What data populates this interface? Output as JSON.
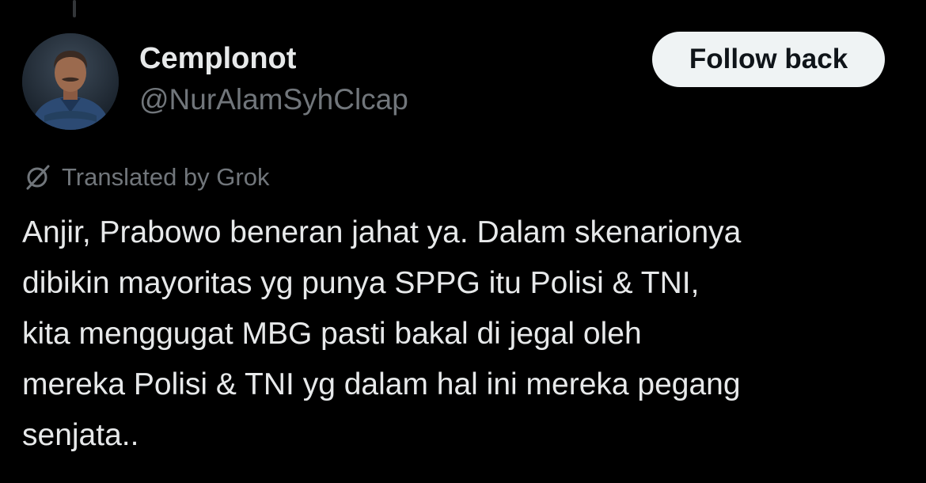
{
  "author": {
    "display_name": "Cemplonot",
    "handle": "@NurAlamSyhClcap",
    "avatar_icon": "profile-photo"
  },
  "actions": {
    "follow_label": "Follow back"
  },
  "translation": {
    "icon": "translate-slash-icon",
    "label": "Translated by Grok"
  },
  "tweet": {
    "lines": [
      "Anjir, Prabowo beneran jahat ya. Dalam skenarionya",
      "dibikin mayoritas yg punya SPPG itu Polisi & TNI,",
      "kita menggugat MBG pasti bakal di jegal oleh",
      "mereka Polisi & TNI yg dalam hal ini mereka pegang",
      "senjata.."
    ]
  },
  "colors": {
    "background": "#000000",
    "primary_text": "#e7e9ea",
    "secondary_text": "#71767b",
    "button_bg": "#eff3f4",
    "button_text": "#0f1419"
  }
}
